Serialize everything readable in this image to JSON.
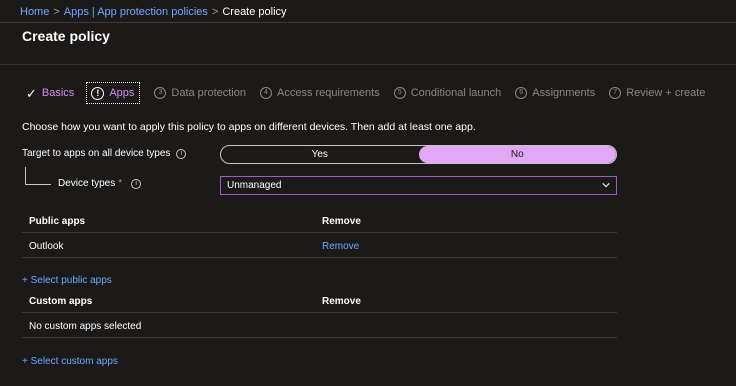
{
  "breadcrumb": {
    "home": "Home",
    "apps": "Apps | App protection policies",
    "current": "Create policy",
    "separator": ">"
  },
  "page": {
    "title": "Create policy"
  },
  "wizard": {
    "steps": [
      {
        "num": "",
        "label": "Basics",
        "state": "done"
      },
      {
        "num": "!",
        "label": "Apps",
        "state": "current"
      },
      {
        "num": "3",
        "label": "Data protection",
        "state": "pending"
      },
      {
        "num": "4",
        "label": "Access requirements",
        "state": "pending"
      },
      {
        "num": "5",
        "label": "Conditional launch",
        "state": "pending"
      },
      {
        "num": "6",
        "label": "Assignments",
        "state": "pending"
      },
      {
        "num": "7",
        "label": "Review + create",
        "state": "pending"
      }
    ]
  },
  "description": "Choose how you want to apply this policy to apps on different devices. Then add at least one app.",
  "target": {
    "label": "Target to apps on all device types",
    "info": "i",
    "options": [
      "Yes",
      "No"
    ],
    "selected": "No"
  },
  "device_types": {
    "label": "Device types",
    "required_mark": "*",
    "info": "i",
    "value": "Unmanaged"
  },
  "public_apps": {
    "headers": [
      "Public apps",
      "Remove"
    ],
    "rows": [
      {
        "name": "Outlook",
        "action": "Remove"
      }
    ],
    "add_link": "+ Select public apps"
  },
  "custom_apps": {
    "headers": [
      "Custom apps",
      "Remove"
    ],
    "empty_text": "No custom apps selected",
    "add_link": "+ Select custom apps"
  },
  "colors": {
    "background": "#1b1a19",
    "accent": "#d08ef0",
    "toggle_selected": "#e3a8f5",
    "link": "#6ea8fe"
  },
  "icons": {
    "check": "checkmark-icon",
    "current_step": "info-circle-icon",
    "chevron": "chevron-down-icon"
  }
}
